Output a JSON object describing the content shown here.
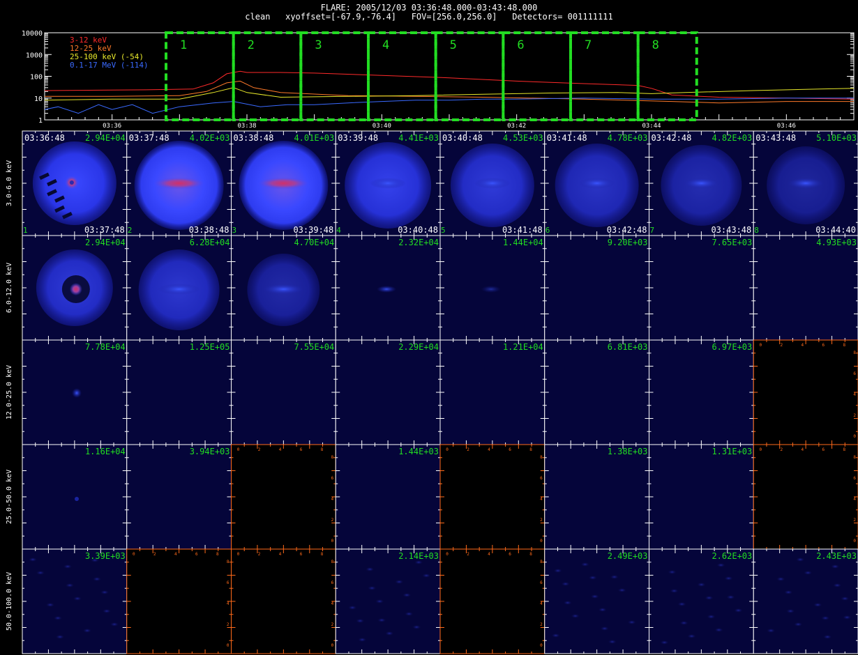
{
  "header": {
    "line1": "FLARE: 2005/12/03 03:36:48.000-03:43:48.000",
    "line2": "clean   xyoffset=[-67.9,-76.4]   FOV=[256.0,256.0]   Detectors= 001111111"
  },
  "colors": {
    "green": "#22dd22",
    "orange": "#ff6a1a",
    "grid": "#ffffff",
    "panel_bg": "#05053a",
    "empty_bg": "#000000"
  },
  "chart_data": [
    {
      "type": "line",
      "title": "",
      "yscale": "log",
      "ylim": [
        1,
        10000
      ],
      "yticks": [
        "1",
        "10",
        "100",
        "1000",
        "10000"
      ],
      "xlim_minutes": [
        35.0,
        47.0
      ],
      "xticks": [
        "03:36",
        "03:38",
        "03:40",
        "03:42",
        "03:44",
        "03:46"
      ],
      "xtick_minutes": [
        36,
        38,
        40,
        42,
        44,
        46
      ],
      "series": [
        {
          "name": "3-12 keV",
          "color": "#ff2a2a",
          "points": [
            [
              35.0,
              22
            ],
            [
              35.8,
              23
            ],
            [
              36.5,
              24
            ],
            [
              37.2,
              26
            ],
            [
              37.5,
              50
            ],
            [
              37.7,
              130
            ],
            [
              37.9,
              170
            ],
            [
              38.0,
              150
            ],
            [
              38.5,
              150
            ],
            [
              39.0,
              140
            ],
            [
              40.0,
              110
            ],
            [
              41.0,
              85
            ],
            [
              42.0,
              60
            ],
            [
              43.0,
              46
            ],
            [
              43.8,
              38
            ],
            [
              44.0,
              28
            ],
            [
              44.3,
              14
            ],
            [
              45.0,
              11
            ],
            [
              46.0,
              10
            ],
            [
              47.0,
              9
            ]
          ]
        },
        {
          "name": "12-25 keV",
          "color": "#ff7a2a",
          "points": [
            [
              35.0,
              12
            ],
            [
              36.0,
              12
            ],
            [
              37.0,
              13
            ],
            [
              37.4,
              20
            ],
            [
              37.7,
              50
            ],
            [
              37.9,
              60
            ],
            [
              38.1,
              30
            ],
            [
              38.5,
              18
            ],
            [
              39.5,
              13
            ],
            [
              40.5,
              12
            ],
            [
              41.5,
              11
            ],
            [
              43.0,
              9
            ],
            [
              44.3,
              7
            ],
            [
              45.0,
              6
            ],
            [
              46.0,
              7
            ],
            [
              47.0,
              7
            ]
          ]
        },
        {
          "name": "25-100 keV (-54)",
          "color": "#e8e82a",
          "points": [
            [
              35.0,
              8
            ],
            [
              36.0,
              9
            ],
            [
              37.0,
              9
            ],
            [
              37.5,
              18
            ],
            [
              37.8,
              30
            ],
            [
              38.0,
              18
            ],
            [
              38.5,
              11
            ],
            [
              39.5,
              12
            ],
            [
              40.5,
              13
            ],
            [
              41.5,
              15
            ],
            [
              42.5,
              17
            ],
            [
              43.5,
              18
            ],
            [
              44.0,
              16
            ],
            [
              44.5,
              18
            ],
            [
              45.5,
              22
            ],
            [
              46.5,
              26
            ],
            [
              47.0,
              28
            ]
          ]
        },
        {
          "name": "0.1-17 MeV (-114)",
          "color": "#3a6aff",
          "points": [
            [
              35.0,
              3
            ],
            [
              35.2,
              4
            ],
            [
              35.5,
              2
            ],
            [
              35.8,
              5
            ],
            [
              36.0,
              3
            ],
            [
              36.3,
              5
            ],
            [
              36.6,
              2
            ],
            [
              37.0,
              4
            ],
            [
              37.5,
              6
            ],
            [
              37.8,
              7
            ],
            [
              38.2,
              4
            ],
            [
              38.6,
              5
            ],
            [
              39.0,
              5
            ],
            [
              39.5,
              6
            ],
            [
              40.0,
              7
            ],
            [
              40.5,
              8
            ],
            [
              41.0,
              8
            ],
            [
              41.5,
              9
            ],
            [
              42.0,
              9
            ],
            [
              43.0,
              10
            ],
            [
              44.0,
              9
            ],
            [
              44.5,
              9
            ],
            [
              45.0,
              9
            ],
            [
              46.0,
              10
            ],
            [
              47.0,
              10
            ]
          ]
        }
      ],
      "intervals": [
        "1",
        "2",
        "3",
        "4",
        "5",
        "6",
        "7",
        "8"
      ],
      "interval_minutes": [
        [
          36.8,
          37.8
        ],
        [
          37.8,
          38.8
        ],
        [
          38.8,
          39.8
        ],
        [
          39.8,
          40.8
        ],
        [
          40.8,
          41.8
        ],
        [
          41.8,
          42.8
        ],
        [
          42.8,
          43.8
        ],
        [
          43.8,
          44.67
        ]
      ]
    },
    {
      "type": "heatmap",
      "rows": [
        "3.0-6.0 keV",
        "6.0-12.0 keV",
        "12.0-25.0 keV",
        "25.0-50.0 keV",
        "50.0-100.0 keV"
      ],
      "row_start_times": [
        "03:36:48",
        "03:37:48",
        "03:38:48",
        "03:39:48",
        "03:40:48",
        "03:41:48",
        "03:42:48",
        "03:43:48"
      ],
      "row_end_times": [
        "03:37:48",
        "03:38:48",
        "03:39:48",
        "03:40:48",
        "03:41:48",
        "03:42:48",
        "03:43:48",
        "03:44:40"
      ],
      "panel_numbers": [
        "1",
        "2",
        "3",
        "4",
        "5",
        "6",
        "7",
        "8"
      ],
      "max_values": [
        [
          "2.94E+04",
          "4.02E+03",
          "4.01E+03",
          "4.41E+03",
          "4.53E+03",
          "4.78E+03",
          "4.82E+03",
          "5.10E+03"
        ],
        [
          "2.94E+04",
          "6.28E+04",
          "4.70E+04",
          "2.32E+04",
          "1.44E+04",
          "9.20E+03",
          "7.65E+03",
          "4.93E+03"
        ],
        [
          "7.78E+04",
          "1.25E+05",
          "7.55E+04",
          "2.29E+04",
          "1.21E+04",
          "6.81E+03",
          "6.97E+03",
          ""
        ],
        [
          "1.16E+04",
          "3.94E+03",
          "",
          "1.44E+03",
          "",
          "1.38E+03",
          "1.31E+03",
          ""
        ],
        [
          "3.39E+03",
          "",
          "",
          "2.14E+03",
          "",
          "2.49E+03",
          "2.62E+03",
          "2.43E+03"
        ]
      ],
      "empty_panel_tick_labels": [
        "0",
        "2",
        "4",
        "6",
        "8"
      ]
    }
  ]
}
